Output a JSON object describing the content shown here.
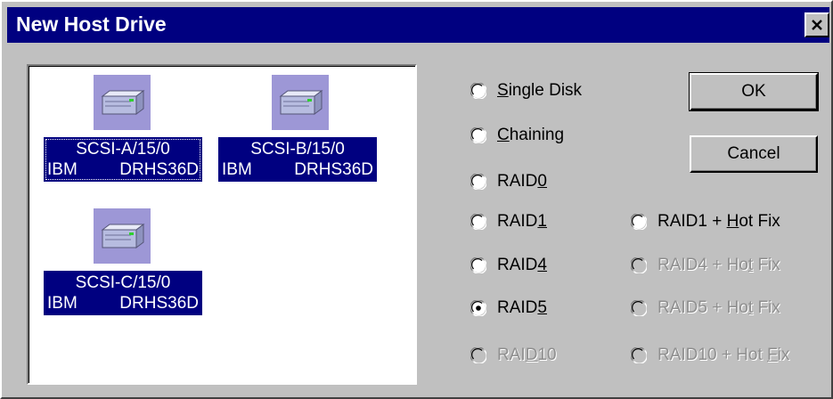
{
  "window": {
    "title": "New Host Drive",
    "close_icon": "close-icon"
  },
  "drives": [
    {
      "name": "SCSI-A/15/0",
      "vendor": "IBM",
      "model": "DRHS36D",
      "icon": "disk-drive-icon",
      "focused": true
    },
    {
      "name": "SCSI-B/15/0",
      "vendor": "IBM",
      "model": "DRHS36D",
      "icon": "disk-drive-icon",
      "focused": false
    },
    {
      "name": "SCSI-C/15/0",
      "vendor": "IBM",
      "model": "DRHS36D",
      "icon": "disk-drive-icon",
      "focused": false
    }
  ],
  "raid_options": {
    "single_disk": {
      "pre": "",
      "key": "S",
      "post": "ingle Disk",
      "enabled": true,
      "checked": false
    },
    "chaining": {
      "pre": "",
      "key": "C",
      "post": "haining",
      "enabled": true,
      "checked": false
    },
    "raid0": {
      "pre": "RAID",
      "key": "0",
      "post": "",
      "enabled": true,
      "checked": false
    },
    "raid1": {
      "pre": "RAID",
      "key": "1",
      "post": "",
      "enabled": true,
      "checked": false
    },
    "raid4": {
      "pre": "RAID",
      "key": "4",
      "post": "",
      "enabled": true,
      "checked": false
    },
    "raid5": {
      "pre": "RAID",
      "key": "5",
      "post": "",
      "enabled": true,
      "checked": true
    },
    "raid10": {
      "pre": "RAI",
      "key": "D",
      "post": "10",
      "enabled": false,
      "checked": false
    },
    "raid1_hotfix": {
      "pre": "RAID1 + ",
      "key": "H",
      "post": "ot Fix",
      "enabled": true,
      "checked": false
    },
    "raid4_hotfix": {
      "pre": "RAID4 + Ho",
      "key": "t",
      "post": " Fix",
      "enabled": false,
      "checked": false
    },
    "raid5_hotfix": {
      "pre": "RAID5 + Ho",
      "key": "t",
      "post": " Fix",
      "enabled": false,
      "checked": false
    },
    "raid10_hotfix": {
      "pre": "RAID10 + Hot ",
      "key": "F",
      "post": "ix",
      "enabled": false,
      "checked": false
    }
  },
  "buttons": {
    "ok": "OK",
    "cancel": "Cancel"
  },
  "colors": {
    "dialog_bg": "#c0c0c0",
    "titlebar": "#000080",
    "selection": "#000080",
    "drive_icon_bg": "#9d97d6",
    "disabled_text": "#8f8f8f"
  }
}
